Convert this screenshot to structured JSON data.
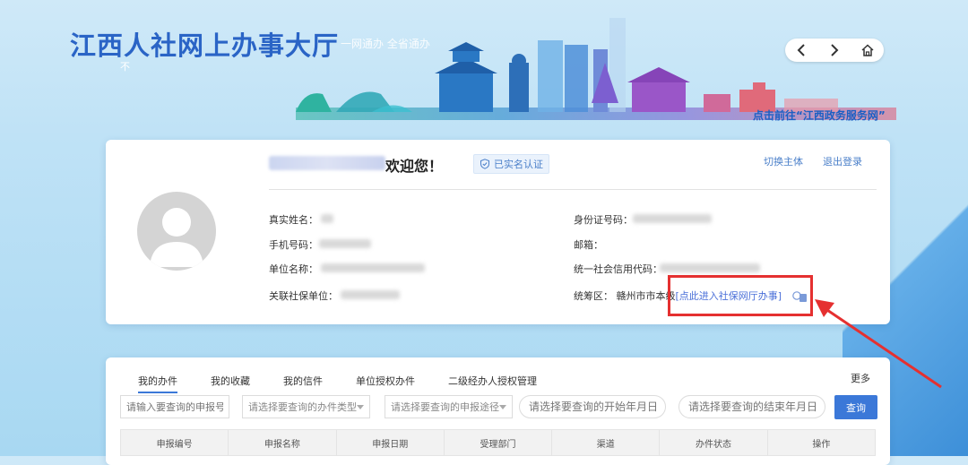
{
  "header": {
    "title": "江西人社网上办事大厅",
    "slogan": "一网通办 全省通办",
    "small_char": "不",
    "gov_link": "点击前往“江西政务服务网”",
    "nav": [
      "chevron-left-icon",
      "chevron-right-icon",
      "home-icon"
    ]
  },
  "profile": {
    "welcome": "欢迎您！",
    "verified_badge": "已实名认证",
    "switch_subject": "切换主体",
    "logout": "退出登录",
    "fields": {
      "real_name": "真实姓名：",
      "id_number": "身份证号码：",
      "phone": "手机号码：",
      "email": "邮箱：",
      "unit_name": "单位名称：",
      "credit_code": "统一社会信用代码：",
      "linked_unit": "关联社保单位：",
      "region": "统筹区：",
      "region_value": "赣州市市本级",
      "enter_link": "[点此进入社保网厅办事]"
    }
  },
  "tasks": {
    "tabs": [
      "我的办件",
      "我的收藏",
      "我的信件",
      "单位授权办件",
      "二级经办人授权管理"
    ],
    "more": "更多",
    "filters": {
      "report_no_placeholder": "请输入要查询的申报号",
      "type_placeholder": "请选择要查询的办件类型",
      "channel_placeholder": "请选择要查询的申报途径",
      "start_date_placeholder": "请选择要查询的开始年月日",
      "end_date_placeholder": "请选择要查询的结束年月日",
      "query_button": "查询"
    },
    "columns": [
      "申报编号",
      "申报名称",
      "申报日期",
      "受理部门",
      "渠道",
      "办件状态",
      "操作"
    ]
  },
  "colors": {
    "accent": "#3b78d8",
    "title": "#2a64c6",
    "highlight_box": "#e53030"
  }
}
